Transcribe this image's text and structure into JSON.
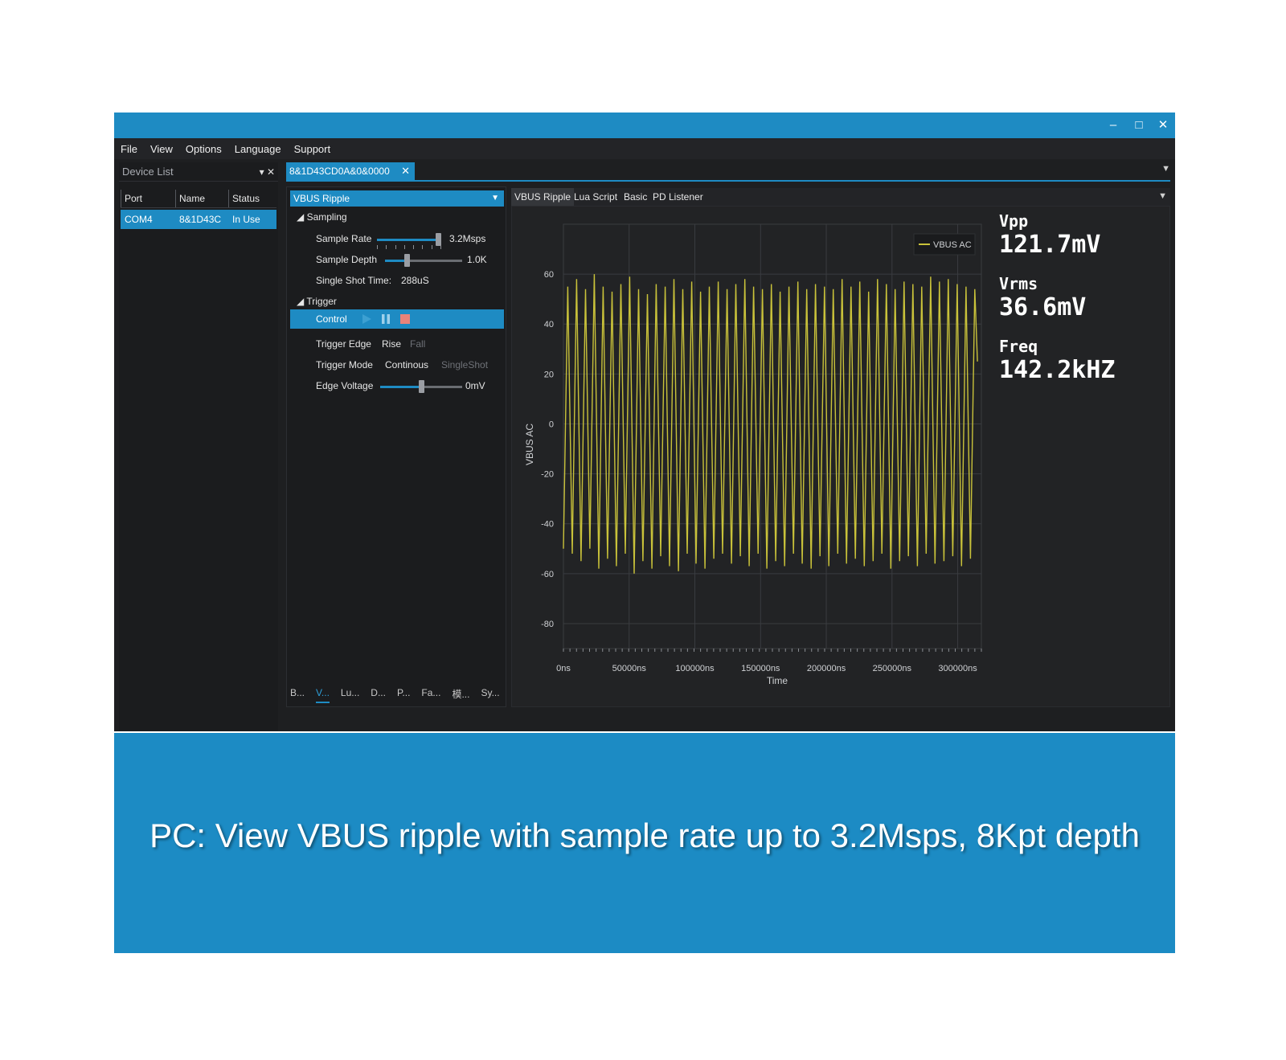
{
  "menu": [
    "File",
    "View",
    "Options",
    "Language",
    "Support"
  ],
  "window_controls": {
    "minimize": "–",
    "maximize": "□",
    "close": "✕"
  },
  "device_list": {
    "title": "Device List",
    "columns": [
      "Port",
      "Name",
      "Status"
    ],
    "rows": [
      {
        "port": "COM4",
        "name": "8&1D43C",
        "status": "In Use"
      }
    ]
  },
  "doc_tab": {
    "label": "8&1D43CD0A&0&0000",
    "close": "✕"
  },
  "settings": {
    "mode": "VBUS Ripple",
    "sampling": {
      "group": "Sampling",
      "sample_rate_label": "Sample Rate",
      "sample_rate_value": "3.2Msps",
      "sample_rate_level": 1.0,
      "sample_depth_label": "Sample Depth",
      "sample_depth_value": "1.0K",
      "sample_depth_level": 0.28,
      "single_shot_label": "Single Shot Time:",
      "single_shot_value": "288uS"
    },
    "trigger": {
      "group": "Trigger",
      "control_label": "Control",
      "edge_label": "Trigger Edge",
      "edge_options": [
        "Rise",
        "Fall"
      ],
      "edge_selected": "Rise",
      "mode_label": "Trigger Mode",
      "mode_options": [
        "Continous",
        "SingleShot"
      ],
      "mode_selected": "Continous",
      "voltage_label": "Edge Voltage",
      "voltage_value": "0mV",
      "voltage_level": 0.5
    },
    "bottom_tabs": [
      "B...",
      "V...",
      "Lu...",
      "D...",
      "P...",
      "Fa...",
      "模...",
      "Sy..."
    ],
    "bottom_tab_active": "V..."
  },
  "inner_tabs": [
    "VBUS Ripple",
    "Lua Script",
    "Basic",
    "PD Listener"
  ],
  "inner_tab_active": "VBUS Ripple",
  "readouts": [
    {
      "label": "Vpp",
      "value": "121.7mV"
    },
    {
      "label": "Vrms",
      "value": "36.6mV"
    },
    {
      "label": "Freq",
      "value": "142.2kHZ"
    }
  ],
  "colors": {
    "accent": "#1e8bc3",
    "trace": "#c9c23a",
    "background": "#1e1f21"
  },
  "chart_data": {
    "type": "line",
    "xlabel": "Time",
    "ylabel": "VBUS AC",
    "xlim": [
      0,
      318000
    ],
    "ylim": [
      -90,
      80
    ],
    "x_ticks": [
      "0ns",
      "50000ns",
      "100000ns",
      "150000ns",
      "200000ns",
      "250000ns",
      "300000ns"
    ],
    "x_tick_values": [
      0,
      50000,
      100000,
      150000,
      200000,
      250000,
      300000
    ],
    "y_ticks": [
      60,
      40,
      20,
      0,
      -20,
      -40,
      -60,
      -80
    ],
    "grid": true,
    "legend_position": "top-right",
    "series": [
      {
        "name": "VBUS AC",
        "x": [
          0,
          3300,
          6700,
          10000,
          13400,
          16800,
          20100,
          23500,
          26900,
          30200,
          33600,
          37000,
          40300,
          43700,
          47100,
          50400,
          53800,
          57200,
          60500,
          63900,
          67300,
          70600,
          74000,
          77400,
          80700,
          84100,
          87500,
          90800,
          94200,
          97600,
          100900,
          104300,
          107700,
          111000,
          114400,
          117800,
          121100,
          124500,
          127900,
          131200,
          134600,
          138000,
          141300,
          144700,
          148100,
          151400,
          154800,
          158200,
          161500,
          164900,
          168300,
          171600,
          175000,
          178400,
          181700,
          185100,
          188500,
          191800,
          195200,
          198600,
          201900,
          205300,
          208700,
          212000,
          215400,
          218800,
          222100,
          225500,
          228900,
          232200,
          235600,
          239000,
          242300,
          245700,
          249100,
          252400,
          255800,
          259200,
          262500,
          265900,
          269300,
          272600,
          276000,
          279400,
          282700,
          286100,
          289500,
          292800,
          296200,
          299600,
          302900,
          306300,
          309700,
          313000,
          315000
        ],
        "y": [
          -50,
          55,
          -52,
          58,
          -55,
          54,
          -50,
          60,
          -58,
          55,
          -54,
          53,
          -57,
          56,
          -52,
          59,
          -60,
          54,
          -55,
          52,
          -58,
          56,
          -53,
          55,
          -57,
          58,
          -59,
          54,
          -52,
          57,
          -56,
          53,
          -58,
          55,
          -54,
          57,
          -52,
          54,
          -56,
          56,
          -53,
          58,
          -57,
          55,
          -52,
          54,
          -58,
          56,
          -55,
          53,
          -57,
          55,
          -52,
          57,
          -56,
          54,
          -58,
          56,
          -53,
          55,
          -57,
          54,
          -52,
          58,
          -56,
          55,
          -54,
          57,
          -57,
          53,
          -55,
          58,
          -52,
          56,
          -58,
          54,
          -55,
          57,
          -53,
          56,
          -57,
          55,
          -52,
          59,
          -56,
          57,
          -55,
          58,
          -53,
          56,
          -57,
          55,
          -54,
          54,
          25
        ]
      }
    ]
  },
  "caption": "PC: View VBUS ripple with sample rate up to 3.2Msps, 8Kpt depth"
}
